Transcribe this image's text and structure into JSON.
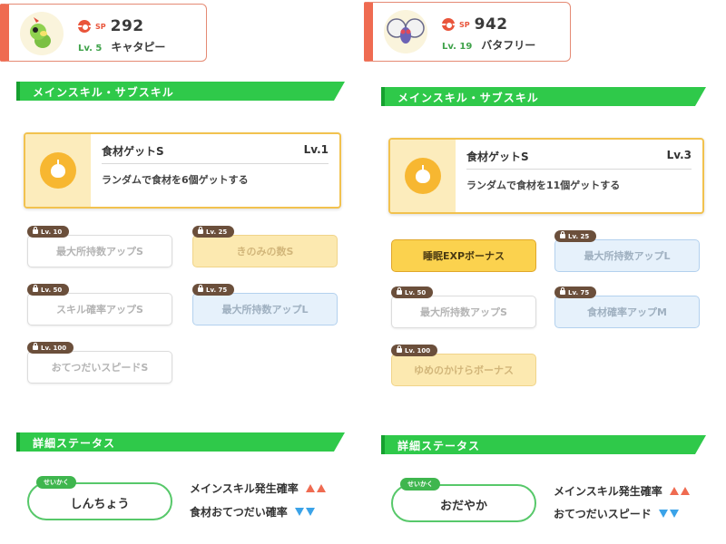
{
  "colors": {
    "accent_red": "#ef6b51",
    "section_green": "#2fc94a",
    "skill_gold": "#f2c24f",
    "increase": "#ef6b51",
    "decrease": "#3ba3e8"
  },
  "left": {
    "header": {
      "sp_label": "SP",
      "sp_value": "292",
      "level": "Lv. 5",
      "name": "キャタピー",
      "avatar_icon": "caterpie-avatar"
    },
    "skills_section_title": "メインスキル・サブスキル",
    "main_skill": {
      "name": "食材ゲットS",
      "level": "Lv.1",
      "description": "ランダムで食材を6個ゲットする",
      "icon": "apple-icon"
    },
    "sub_skills": [
      {
        "unlock": "Lv. 10",
        "label": "最大所持数アップS"
      },
      {
        "unlock": "Lv. 25",
        "label": "きのみの数S"
      },
      {
        "unlock": "Lv. 50",
        "label": "スキル確率アップS"
      },
      {
        "unlock": "Lv. 75",
        "label": "最大所持数アップL"
      },
      {
        "unlock": "Lv. 100",
        "label": "おてつだいスピードS"
      }
    ],
    "status_section_title": "詳細ステータス",
    "nature": {
      "badge": "せいかく",
      "value": "しんちょう"
    },
    "effects": [
      {
        "label": "メインスキル発生確率",
        "direction": "up"
      },
      {
        "label": "食材おてつだい確率",
        "direction": "down"
      }
    ]
  },
  "right": {
    "header": {
      "sp_label": "SP",
      "sp_value": "942",
      "level": "Lv. 19",
      "name": "バタフリー",
      "avatar_icon": "butterfree-avatar"
    },
    "skills_section_title": "メインスキル・サブスキル",
    "main_skill": {
      "name": "食材ゲットS",
      "level": "Lv.3",
      "description": "ランダムで食材を11個ゲットする",
      "icon": "apple-icon"
    },
    "sub_skills": [
      {
        "unlock": "",
        "label": "睡眠EXPボーナス"
      },
      {
        "unlock": "Lv. 25",
        "label": "最大所持数アップL"
      },
      {
        "unlock": "Lv. 50",
        "label": "最大所持数アップS"
      },
      {
        "unlock": "Lv. 75",
        "label": "食材確率アップM"
      },
      {
        "unlock": "Lv. 100",
        "label": "ゆめのかけらボーナス"
      }
    ],
    "status_section_title": "詳細ステータス",
    "nature": {
      "badge": "せいかく",
      "value": "おだやか"
    },
    "effects": [
      {
        "label": "メインスキル発生確率",
        "direction": "up"
      },
      {
        "label": "おてつだいスピード",
        "direction": "down"
      }
    ]
  }
}
